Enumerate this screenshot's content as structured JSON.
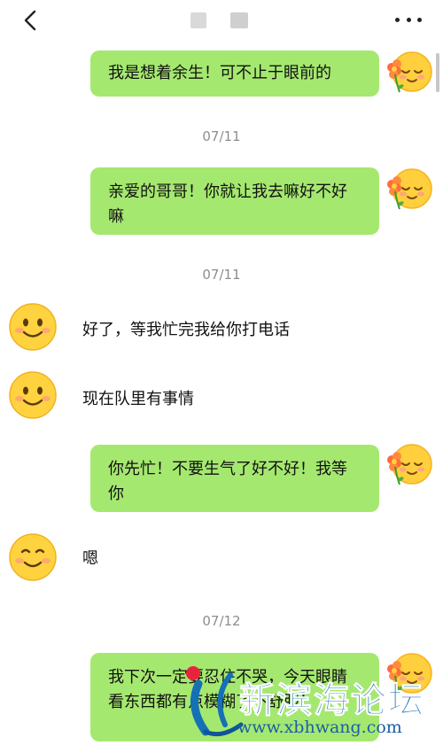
{
  "header": {
    "back_icon": "chevron-left-icon",
    "more_icon": "ellipsis-icon"
  },
  "messages": [
    {
      "side": "out",
      "text": "我是想着余生！可不止于眼前的"
    },
    {
      "side": "time",
      "text": "07/11"
    },
    {
      "side": "out",
      "text": "亲爱的哥哥！你就让我去嘛好不好嘛"
    },
    {
      "side": "time",
      "text": "07/11"
    },
    {
      "side": "in",
      "text": "好了，等我忙完我给你打电话"
    },
    {
      "side": "in",
      "text": "现在队里有事情"
    },
    {
      "side": "out",
      "text": "你先忙！不要生气了好不好！我等你"
    },
    {
      "side": "in",
      "text": "嗯"
    },
    {
      "side": "time",
      "text": "07/12"
    },
    {
      "side": "out",
      "text": "我下次一定要忍住不哭，今天眼睛看东西都有点模糊了不舒服！"
    }
  ],
  "watermark": {
    "title": "新滨海论坛",
    "url": "www.xbhwang.com"
  },
  "colors": {
    "bubble_out": "#a5e86f",
    "timestamp": "#8e8e8e",
    "watermark": "#1670b5"
  }
}
